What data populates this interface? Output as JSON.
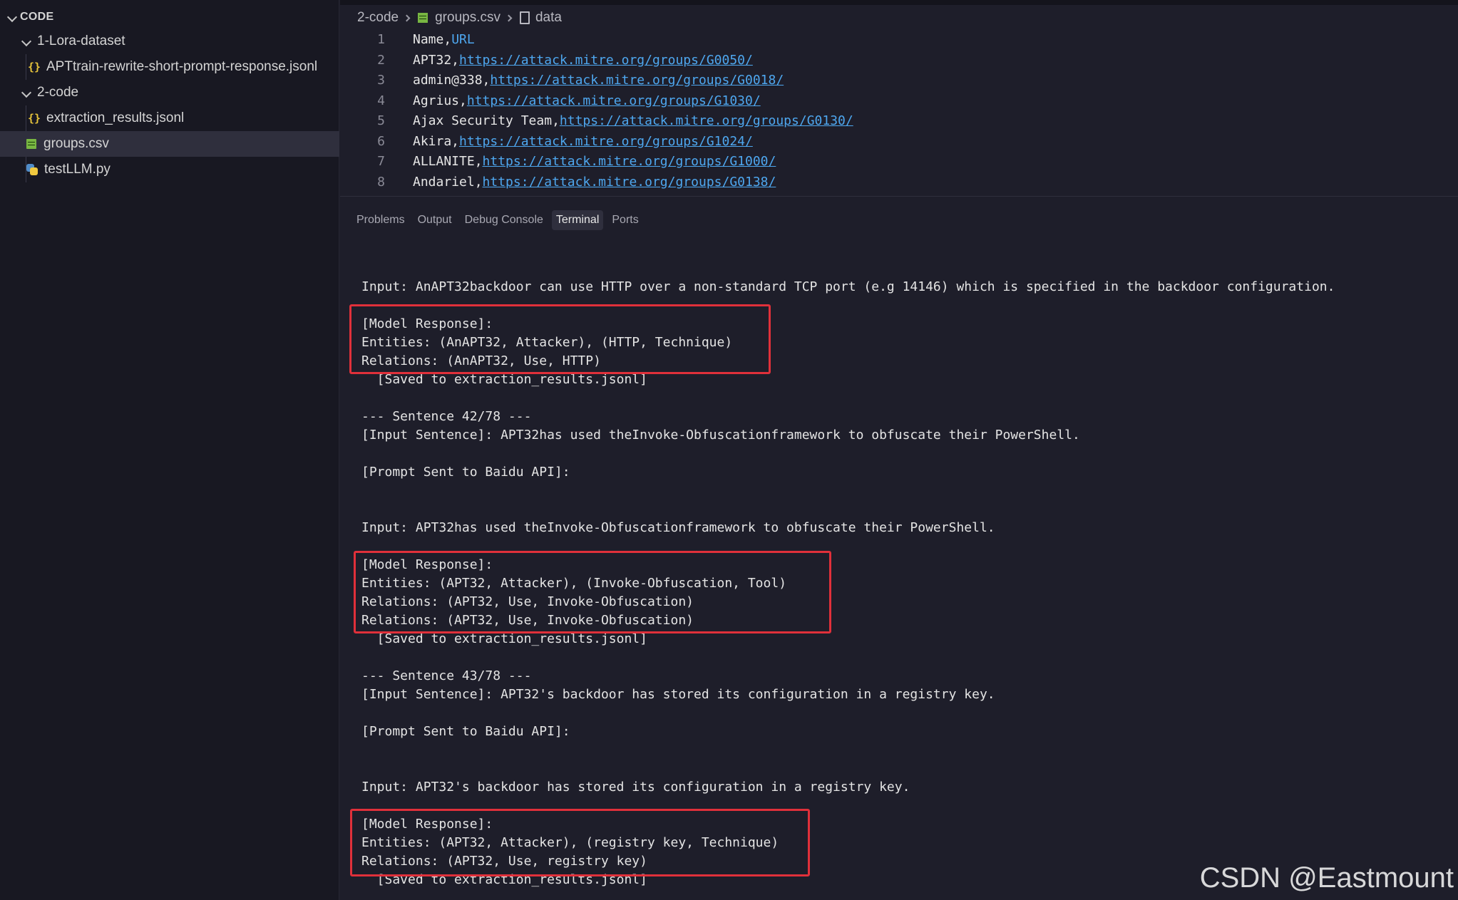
{
  "explorer": {
    "root_label": "CODE",
    "items": [
      {
        "label": "1-Lora-dataset",
        "type": "folder"
      },
      {
        "label": "APTtrain-rewrite-short-prompt-response.jsonl",
        "type": "json"
      },
      {
        "label": "2-code",
        "type": "folder"
      },
      {
        "label": "extraction_results.jsonl",
        "type": "json"
      },
      {
        "label": "groups.csv",
        "type": "csv",
        "selected": true
      },
      {
        "label": "testLLM.py",
        "type": "python"
      }
    ]
  },
  "breadcrumb": {
    "folder": "2-code",
    "file": "groups.csv",
    "symbol": "data"
  },
  "editor": {
    "lines": [
      {
        "number": "1",
        "name": "Name,",
        "url": "URL"
      },
      {
        "number": "2",
        "name": "APT32,",
        "url": "https://attack.mitre.org/groups/G0050/"
      },
      {
        "number": "3",
        "name": "admin@338,",
        "url": "https://attack.mitre.org/groups/G0018/"
      },
      {
        "number": "4",
        "name": "Agrius,",
        "url": "https://attack.mitre.org/groups/G1030/"
      },
      {
        "number": "5",
        "name": "Ajax Security Team,",
        "url": "https://attack.mitre.org/groups/G0130/"
      },
      {
        "number": "6",
        "name": "Akira,",
        "url": "https://attack.mitre.org/groups/G1024/"
      },
      {
        "number": "7",
        "name": "ALLANITE,",
        "url": "https://attack.mitre.org/groups/G1000/"
      },
      {
        "number": "8",
        "name": "Andariel,",
        "url": "https://attack.mitre.org/groups/G0138/"
      }
    ]
  },
  "panel": {
    "tabs": [
      "Problems",
      "Output",
      "Debug Console",
      "Terminal",
      "Ports"
    ],
    "active_tab": "Terminal"
  },
  "terminal": {
    "lines": [
      "Input: AnAPT32backdoor can use HTTP over a non-standard TCP port (e.g 14146) which is specified in the backdoor configuration.",
      "",
      "[Model Response]:",
      "Entities: (AnAPT32, Attacker), (HTTP, Technique)",
      "Relations: (AnAPT32, Use, HTTP)",
      "  [Saved to extraction_results.jsonl]",
      "",
      "--- Sentence 42/78 ---",
      "[Input Sentence]: APT32has used theInvoke-Obfuscationframework to obfuscate their PowerShell.",
      "",
      "[Prompt Sent to Baidu API]:",
      "",
      "",
      "Input: APT32has used theInvoke-Obfuscationframework to obfuscate their PowerShell.",
      "",
      "[Model Response]:",
      "Entities: (APT32, Attacker), (Invoke-Obfuscation, Tool)",
      "Relations: (APT32, Use, Invoke-Obfuscation)",
      "Relations: (APT32, Use, Invoke-Obfuscation)",
      "  [Saved to extraction_results.jsonl]",
      "",
      "--- Sentence 43/78 ---",
      "[Input Sentence]: APT32's backdoor has stored its configuration in a registry key.",
      "",
      "[Prompt Sent to Baidu API]:",
      "",
      "",
      "Input: APT32's backdoor has stored its configuration in a registry key.",
      "",
      "[Model Response]:",
      "Entities: (APT32, Attacker), (registry key, Technique)",
      "Relations: (APT32, Use, registry key)",
      "  [Saved to extraction_results.jsonl]"
    ]
  },
  "watermark": "CSDN @Eastmount",
  "colors": {
    "highlight_box": "#e0303a",
    "link": "#4ea7ef",
    "json_icon": "#e5c33b",
    "csv_icon": "#78b642"
  }
}
